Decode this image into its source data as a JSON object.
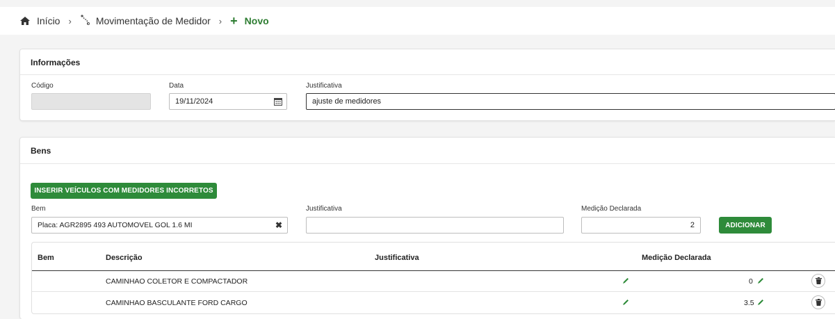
{
  "breadcrumb": {
    "home_label": "Início",
    "section_label": "Movimentação de Medidor",
    "current_label": "Novo",
    "separator": "›"
  },
  "info_panel": {
    "title": "Informações",
    "codigo_label": "Código",
    "codigo_value": "",
    "data_label": "Data",
    "data_value": "19/11/2024",
    "justificativa_label": "Justificativa",
    "justificativa_value": "ajuste de medidores"
  },
  "bens_panel": {
    "title": "Bens",
    "insert_button_label": "INSERIR VEÍCULOS COM MEDIDORES INCORRETOS",
    "bem_label": "Bem",
    "bem_value": "Placa: AGR2895 493 AUTOMOVEL GOL 1.6 MI",
    "justificativa_label": "Justificativa",
    "justificativa_value": "",
    "medicao_label": "Medição Declarada",
    "medicao_value": "2",
    "add_button_label": "ADICIONAR"
  },
  "table": {
    "columns": [
      "Bem",
      "Descrição",
      "Justificativa",
      "Medição Declarada"
    ],
    "rows": [
      {
        "bem": "",
        "descricao": "CAMINHAO COLETOR E COMPACTADOR",
        "justificativa": "",
        "medicao": "0"
      },
      {
        "bem": "",
        "descricao": "CAMINHAO BASCULANTE FORD CARGO",
        "justificativa": "",
        "medicao": "3.5"
      }
    ]
  },
  "colors": {
    "accent_green": "#2e8b3a",
    "breadcrumb_current": "#2e7d32"
  },
  "icons": {
    "home": "home-icon",
    "route": "route-icon",
    "plus": "plus-icon",
    "calendar": "calendar-icon",
    "clear": "clear-icon",
    "edit": "pencil-icon",
    "delete": "trash-icon"
  }
}
